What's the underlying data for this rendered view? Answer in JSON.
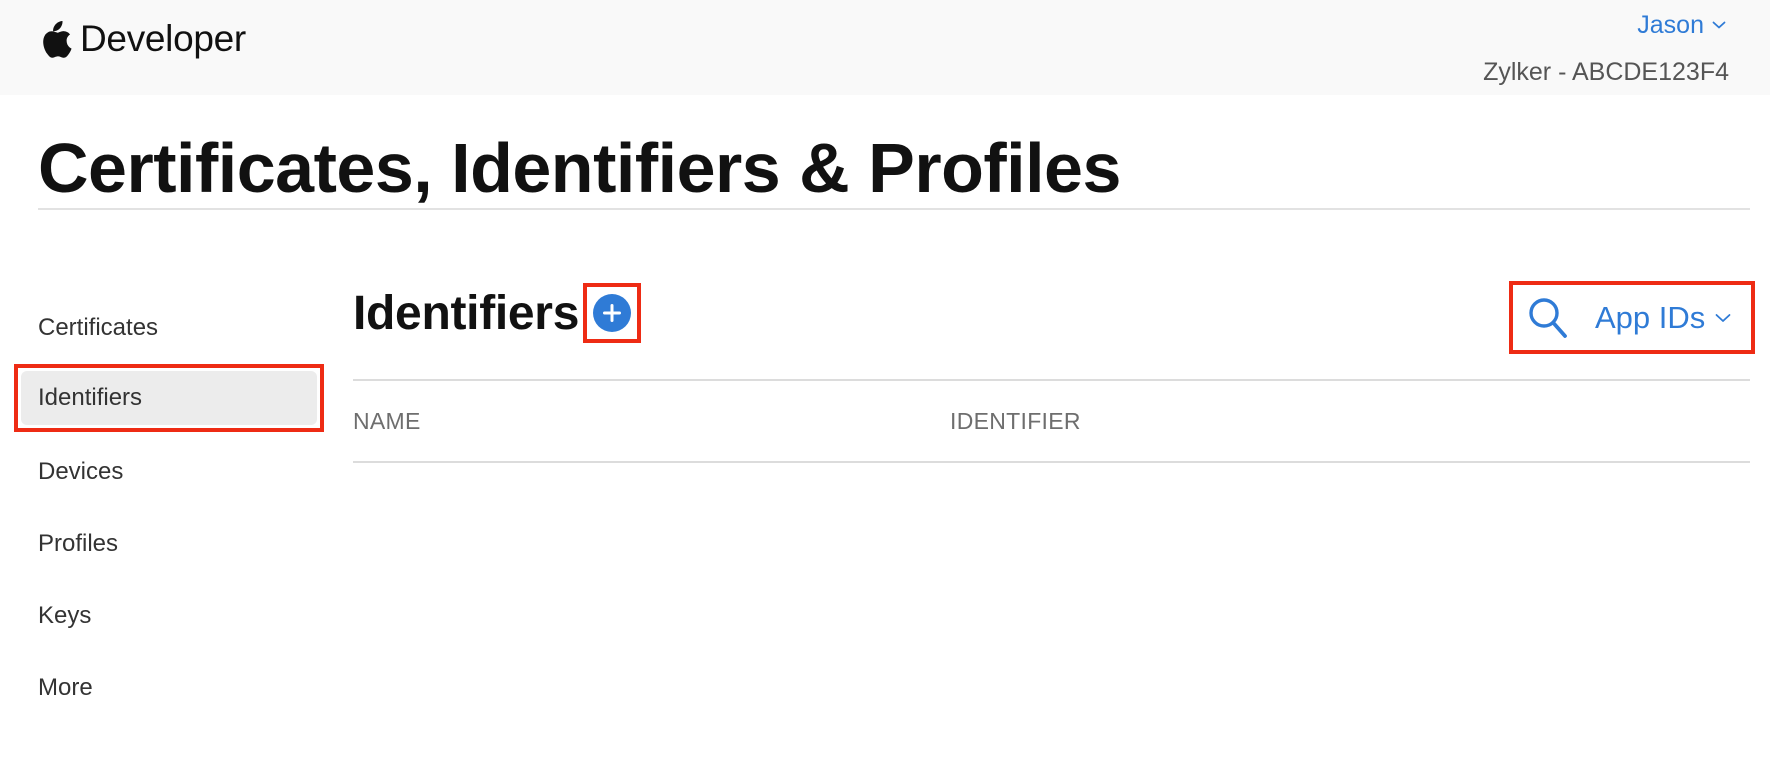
{
  "topbar": {
    "brand": "Developer",
    "account": {
      "user": "Jason",
      "team": "Zylker - ABCDE123F4"
    }
  },
  "page": {
    "title": "Certificates, Identifiers & Profiles"
  },
  "sidebar": {
    "items": [
      {
        "label": "Certificates",
        "active": false
      },
      {
        "label": "Identifiers",
        "active": true
      },
      {
        "label": "Devices",
        "active": false
      },
      {
        "label": "Profiles",
        "active": false
      },
      {
        "label": "Keys",
        "active": false
      },
      {
        "label": "More",
        "active": false
      }
    ]
  },
  "main": {
    "section_title": "Identifiers",
    "filter": {
      "selected": "App IDs"
    },
    "table": {
      "columns": [
        "NAME",
        "IDENTIFIER"
      ],
      "rows": []
    }
  },
  "colors": {
    "accent": "#2f7bd6",
    "highlight": "#ee2b14",
    "topbar_bg": "#f9f9f9",
    "active_item_bg": "#ececec"
  },
  "icons": {
    "brand": "apple-logo-icon",
    "user_menu": "chevron-down-icon",
    "add": "plus-circle-icon",
    "search": "search-icon",
    "filter_menu": "chevron-down-icon"
  }
}
